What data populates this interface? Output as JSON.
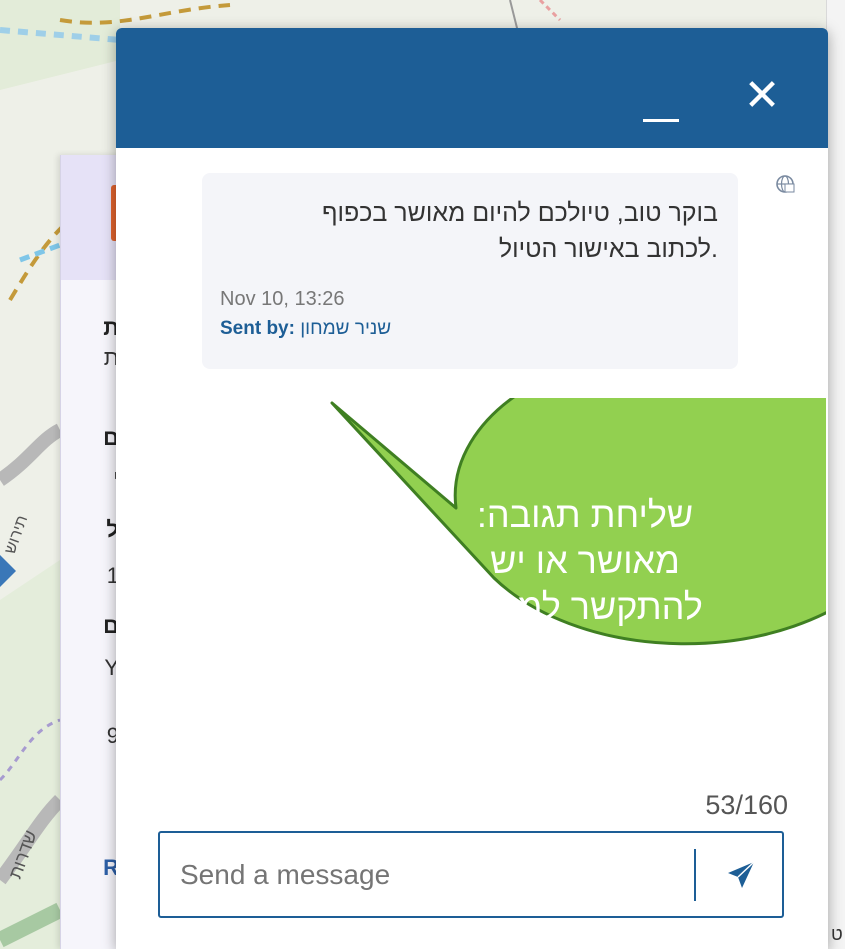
{
  "chat": {
    "minimize_label": "_",
    "close_label": "✕",
    "message": {
      "text_line1": "בוקר טוב, טיולכם להיום מאושר בכפוף",
      "text_line2": ".לכתוב באישור הטיול",
      "time": "Nov 10, 13:26",
      "sender_prefix": "Sent by:",
      "sender_name": "שניר שמחון"
    },
    "callout": {
      "line1": "שליחת תגובה:",
      "line2": "מאושר או יש",
      "line3": "להתקשר למוקד",
      "color": "#92d050"
    },
    "char_counter": "53/160",
    "input_placeholder": "Send a message",
    "header_color": "#1d5e96",
    "send_icon": "send-plane-icon",
    "translate_icon": "translate-icon"
  },
  "background_panel": {
    "fragments": [
      "ת",
      "ת",
      "ם",
      "י",
      "ל",
      "1",
      "ם",
      "Y",
      "9",
      "R"
    ],
    "right_fragment": "ט",
    "accent_color": "#e0632e"
  },
  "map": {
    "street_labels": [
      "תירוש",
      "שדרות"
    ]
  }
}
